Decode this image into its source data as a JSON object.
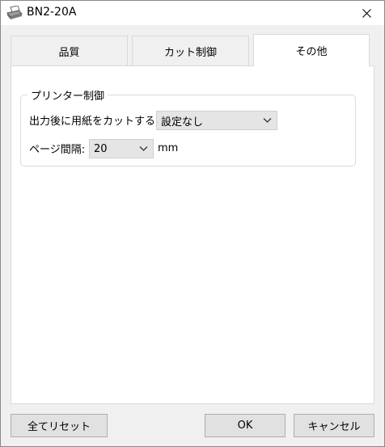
{
  "window": {
    "title": "BN2-20A"
  },
  "tabs": [
    {
      "label": "品質",
      "active": false
    },
    {
      "label": "カット制御",
      "active": false
    },
    {
      "label": "その他",
      "active": true
    }
  ],
  "printer_control": {
    "legend": "プリンター制御",
    "cut_after_output": {
      "label": "出力後に用紙をカットする:",
      "value": "設定なし"
    },
    "page_spacing": {
      "label": "ページ間隔:",
      "value": "20",
      "unit": "mm"
    }
  },
  "buttons": {
    "reset_all": "全てリセット",
    "ok": "OK",
    "cancel": "キャンセル"
  },
  "icons": {
    "app": "printer-icon",
    "close": "close-icon",
    "dropdown": "chevron-down-icon"
  }
}
